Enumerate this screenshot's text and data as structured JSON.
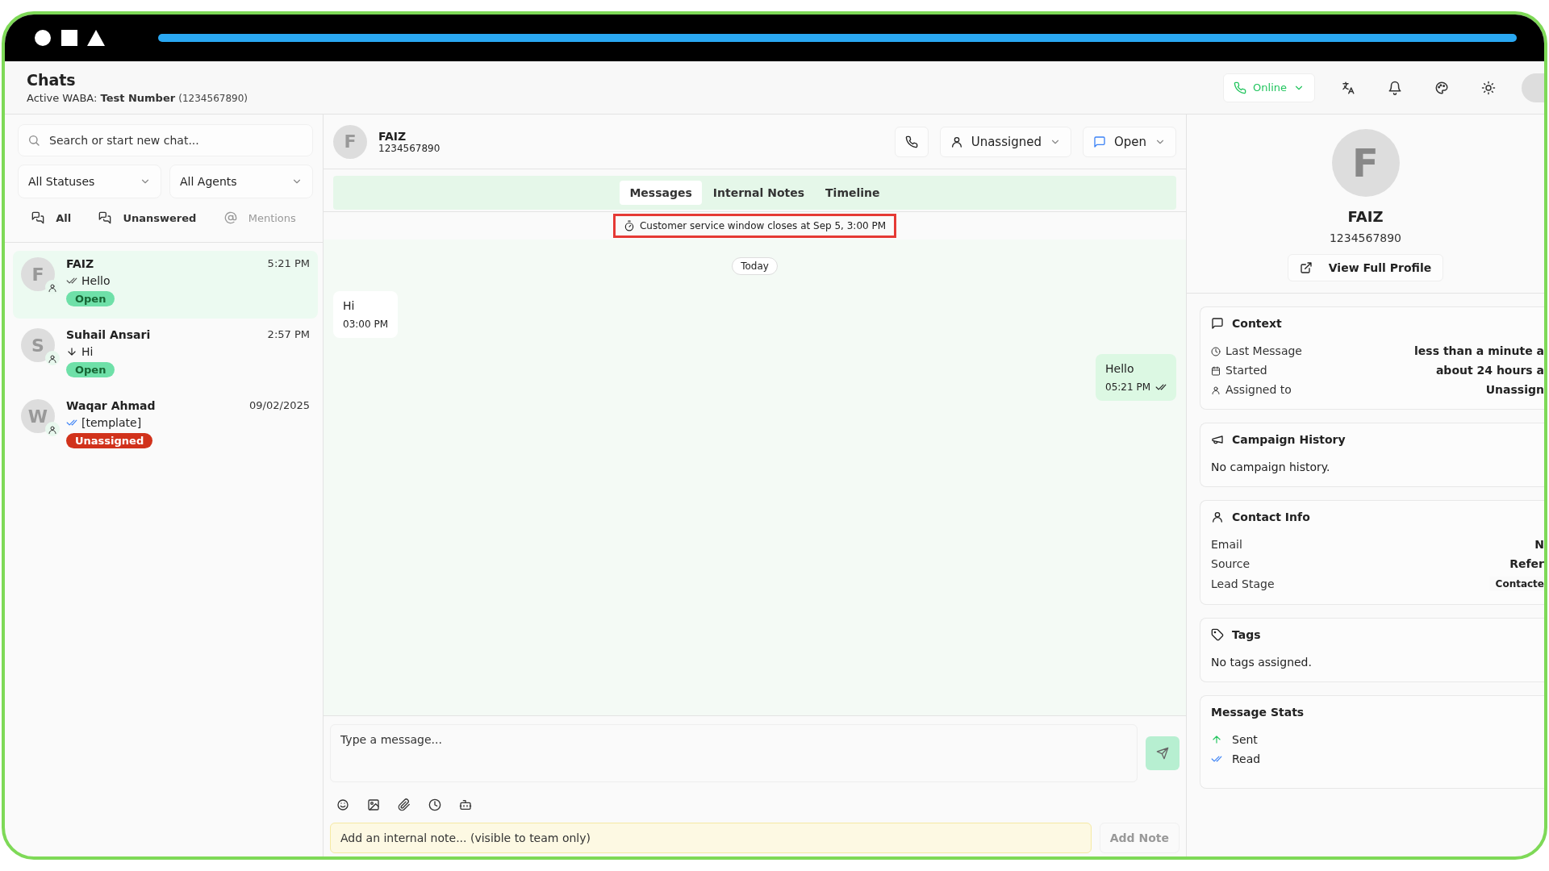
{
  "top_bar": {
    "level": 1
  },
  "header": {
    "title": "Chats",
    "subtitle": "Active WABA: **Test Number**",
    "subtitle_note": "(1234567890)",
    "status_menu": {
      "label": "Online"
    }
  },
  "sidebar": {
    "search": {
      "placeholder": "Search or start new chat..."
    },
    "filters": [
      {
        "label": "All Statuses"
      },
      {
        "label": "All Agents"
      }
    ],
    "tabs": [
      {
        "label": "All",
        "kind": "chats",
        "disabled": false
      },
      {
        "label": "Unanswered",
        "kind": "chats",
        "disabled": false
      },
      {
        "label": "Mentions",
        "kind": "mention",
        "disabled": true
      }
    ],
    "chats": [
      {
        "initial": "F",
        "name": "FAIZ",
        "time": "5:21 PM",
        "kind": "delivered",
        "preview": "Hello",
        "status": {
          "label": "Open",
          "kind": "open"
        },
        "selected": true
      },
      {
        "initial": "S",
        "name": "Suhail Ansari",
        "time": "2:57 PM",
        "kind": "incoming",
        "preview": "Hi",
        "status": {
          "label": "Open",
          "kind": "open"
        },
        "selected": false
      },
      {
        "initial": "W",
        "name": "Waqar Ahmad",
        "time": "09/02/2025",
        "kind": "read",
        "preview": "[template]",
        "status": {
          "label": "Unassigned",
          "kind": "unassigned"
        },
        "selected": false
      }
    ]
  },
  "conversation": {
    "initial": "F",
    "name": "FAIZ",
    "phone": "1234567890",
    "assignee": "Unassigned",
    "status": "Open",
    "tabs": [
      {
        "label": "Messages",
        "selected": true
      },
      {
        "label": "Internal Notes",
        "selected": false
      },
      {
        "label": "Timeline",
        "selected": false
      }
    ],
    "notice": "Customer service window closes at Sep 5, 3:00 PM",
    "date_divider": "Today",
    "messages": [
      {
        "kind": "incoming",
        "text": "Hi",
        "time": "03:00 PM"
      },
      {
        "kind": "outgoing",
        "text": "Hello",
        "time": "05:21 PM"
      }
    ],
    "composer": {
      "placeholder": "Type a message..."
    },
    "note": {
      "placeholder": "Add an internal note... (visible to team only)",
      "button": "Add Note"
    }
  },
  "profile": {
    "initial": "F",
    "name": "FAIZ",
    "phone": "1234567890",
    "button": "View Full Profile",
    "context": {
      "title": "Context",
      "rows": [
        {
          "kind": "clock",
          "label": "Last Message",
          "value": "less than a minute a"
        },
        {
          "kind": "calendar",
          "label": "Started",
          "value": "about 24 hours a"
        },
        {
          "kind": "person",
          "label": "Assigned to",
          "value": "Unassign"
        }
      ]
    },
    "campaign_history": {
      "title": "Campaign History",
      "empty": "No campaign history."
    },
    "contact_info": {
      "title": "Contact Info",
      "rows": [
        {
          "kind": "text",
          "label": "Email",
          "value": "N"
        },
        {
          "kind": "text",
          "label": "Source",
          "value": "Refer"
        },
        {
          "kind": "pill",
          "label": "Lead Stage",
          "value": "Contacte"
        }
      ]
    },
    "tags": {
      "title": "Tags",
      "empty": "No tags assigned."
    },
    "message_stats": {
      "title": "Message Stats",
      "rows": [
        {
          "kind": "sent",
          "label": "Sent"
        },
        {
          "kind": "read",
          "label": "Read"
        }
      ]
    }
  }
}
